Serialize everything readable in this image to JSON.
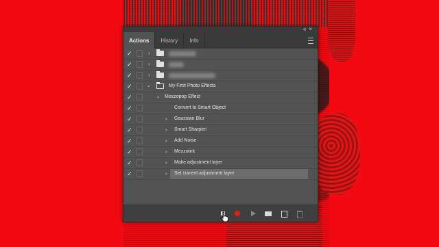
{
  "panel": {
    "tabs": [
      {
        "label": "Actions",
        "active": true
      },
      {
        "label": "History",
        "active": false
      },
      {
        "label": "Info",
        "active": false
      }
    ],
    "rows": [
      {
        "type": "set",
        "checked": true,
        "expanded": false,
        "label": ""
      },
      {
        "type": "set",
        "checked": true,
        "expanded": false,
        "label": ""
      },
      {
        "type": "set",
        "checked": true,
        "expanded": false,
        "label": ""
      },
      {
        "type": "set",
        "checked": true,
        "expanded": true,
        "label": "My First Photo Effects"
      },
      {
        "type": "action",
        "checked": true,
        "expanded": true,
        "label": "Mezzopop Effect"
      },
      {
        "type": "step",
        "checked": true,
        "label": "Convert to Smart Object"
      },
      {
        "type": "step",
        "checked": true,
        "label": "Gaussian Blur"
      },
      {
        "type": "step",
        "checked": true,
        "label": "Smart Sharpen"
      },
      {
        "type": "step",
        "checked": true,
        "label": "Add Noise"
      },
      {
        "type": "step",
        "checked": true,
        "label": "Mezzotint"
      },
      {
        "type": "step",
        "checked": true,
        "label": "Make adjustment layer"
      },
      {
        "type": "step",
        "checked": true,
        "selected": true,
        "label": "Set current adjustment layer"
      }
    ],
    "bottom_buttons": [
      "stop-icon",
      "record-icon",
      "play-icon",
      "new-set-icon",
      "new-action-icon",
      "trash-icon"
    ]
  },
  "colors": {
    "background": "#f20a12",
    "panel": "#535353",
    "record": "#e21b1b"
  }
}
